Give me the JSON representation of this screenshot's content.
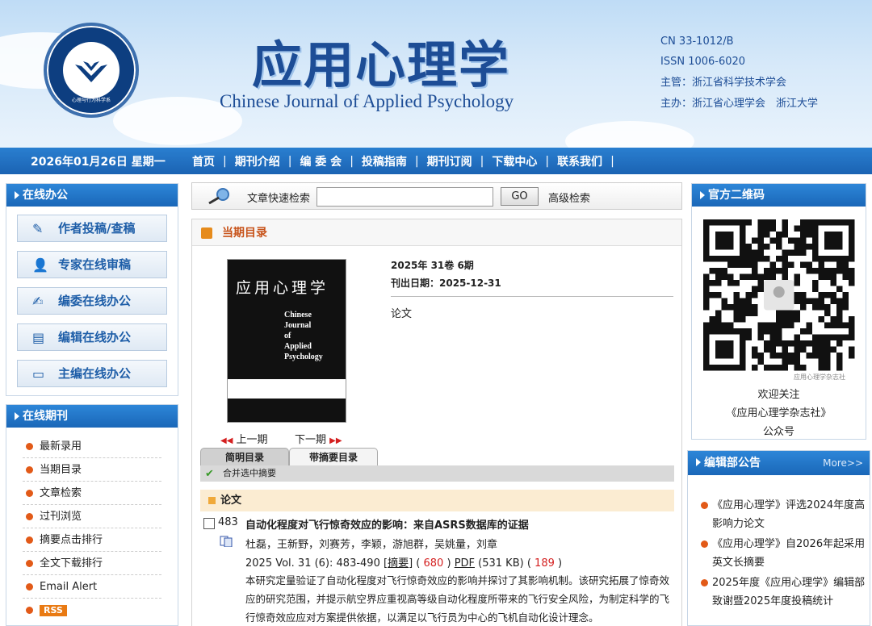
{
  "header": {
    "title_cn": "应用心理学",
    "title_en": "Chinese Journal of Applied Psychology",
    "cn_code": "CN 33-1012/B",
    "issn": "ISSN 1006-6020",
    "sponsor_main": "主管：浙江省科学技术学会",
    "sponsor_host": "主办：浙江省心理学会　浙江大学",
    "logo_text": "心理与行为科学系",
    "logo_univ": "浙江大学"
  },
  "nav": {
    "date": "2026年01月26日 星期一",
    "items": [
      "首页",
      "期刊介绍",
      "编 委 会",
      "投稿指南",
      "期刊订阅",
      "下载中心",
      "联系我们"
    ],
    "sep": "|"
  },
  "online_office": {
    "title": "在线办公",
    "buttons": [
      "作者投稿/查稿",
      "专家在线审稿",
      "编委在线办公",
      "编辑在线办公",
      "主编在线办公"
    ]
  },
  "online_journal": {
    "title": "在线期刊",
    "items": [
      "最新录用",
      "当期目录",
      "文章检索",
      "过刊浏览",
      "摘要点击排行",
      "全文下载排行",
      "Email Alert"
    ],
    "rss": "RSS"
  },
  "search": {
    "label": "文章快速检索",
    "value": "",
    "go": "GO",
    "advanced": "高级检索"
  },
  "current_issue": {
    "heading": "当期目录",
    "cover_title": "应用心理学",
    "cover_en": [
      "Chinese",
      "Journal",
      "of",
      "Applied",
      "Psychology"
    ],
    "volume": "2025年 31卷 6期",
    "pub_date": "刊出日期：2025-12-31",
    "category": "论文",
    "prev": "上一期",
    "next": "下一期",
    "tabs": [
      "简明目录",
      "带摘要目录"
    ],
    "merge_label": "合并选中摘要",
    "section": "论文",
    "article": {
      "page": "483",
      "title": "自动化程度对飞行惊奇效应的影响：来自ASRS数据库的证据",
      "authors": "杜磊，王新野，刘赛芳，李颖，游旭群，吴姚量，刘章",
      "citation": "2025 Vol. 31 (6): 483-490",
      "abstract_link": "摘要",
      "abstract_count": "680",
      "pdf_link": "PDF",
      "pdf_size": "(531 KB)",
      "pdf_count": "189",
      "abstract": "本研究定量验证了自动化程度对飞行惊奇效应的影响并探讨了其影响机制。该研究拓展了惊奇效应的研究范围，并提示航空界应重视高等级自动化程度所带来的飞行安全风险，为制定科学的飞行惊奇效应应对方案提供依据，以满足以飞行员为中心的飞机自动化设计理念。"
    }
  },
  "qrcode": {
    "title": "官方二维码",
    "small_caption": "应用心理学杂志社",
    "caption": [
      "欢迎关注",
      "《应用心理学杂志社》",
      "公众号"
    ]
  },
  "notices": {
    "title": "编辑部公告",
    "more": "More>>",
    "items": [
      "《应用心理学》评选2024年度高影响力论文",
      "《应用心理学》自2026年起采用英文长摘要",
      "2025年度《应用心理学》编辑部致谢暨2025年度投稿统计"
    ]
  },
  "colors": {
    "nav": "#1b63b3",
    "accent": "#c8541b",
    "brand": "#1d4d96"
  }
}
